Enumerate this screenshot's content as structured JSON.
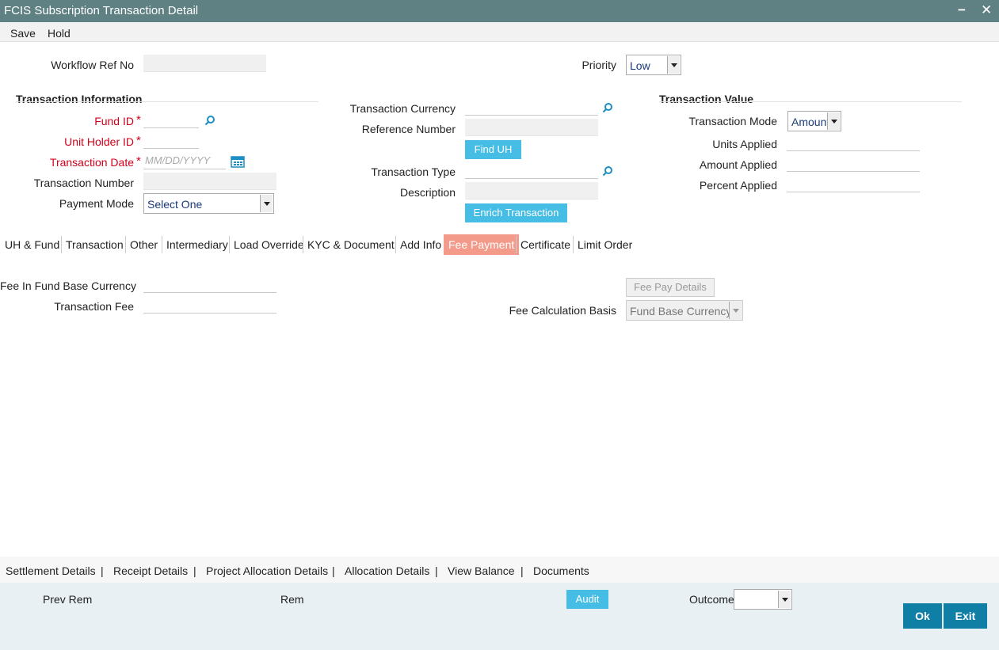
{
  "window": {
    "title": "FCIS Subscription Transaction Detail",
    "minimize_glyph": "−",
    "close_glyph": "✕"
  },
  "menu": {
    "save": "Save",
    "hold": "Hold"
  },
  "header": {
    "workflow_ref_label": "Workflow Ref No",
    "workflow_ref_value": "",
    "priority_label": "Priority",
    "priority_value": "Low"
  },
  "transaction_information": {
    "heading": "Transaction Information",
    "fund_id_label": "Fund ID",
    "unit_holder_id_label": "Unit Holder ID",
    "transaction_date_label": "Transaction Date",
    "transaction_date_placeholder": "MM/DD/YYYY",
    "transaction_number_label": "Transaction Number",
    "payment_mode_label": "Payment Mode",
    "payment_mode_value": "Select One",
    "required_marker": "*"
  },
  "middle": {
    "transaction_currency_label": "Transaction Currency",
    "reference_number_label": "Reference Number",
    "find_uh_button": "Find UH",
    "transaction_type_label": "Transaction Type",
    "description_label": "Description",
    "enrich_button": "Enrich Transaction"
  },
  "transaction_value": {
    "heading": "Transaction Value",
    "mode_label": "Transaction Mode",
    "mode_value": "Amount",
    "units_applied_label": "Units Applied",
    "amount_applied_label": "Amount Applied",
    "percent_applied_label": "Percent Applied"
  },
  "tabs": [
    "UH & Fund",
    "Transaction",
    "Other",
    "Intermediary",
    "Load Override",
    "KYC & Document",
    "Add Info",
    "Fee Payment",
    "Certificate",
    "Limit Order"
  ],
  "active_tab": "Fee Payment",
  "fee_payment": {
    "fee_in_fund_base_label": "Fee In Fund Base Currency",
    "transaction_fee_label": "Transaction Fee",
    "fee_pay_details_button": "Fee Pay Details",
    "fee_calc_basis_label": "Fee Calculation Basis",
    "fee_calc_basis_value": "Fund Base Currency"
  },
  "bottom_links": [
    "Settlement Details",
    "Receipt Details",
    "Project Allocation Details",
    "Allocation Details",
    "View Balance",
    "Documents"
  ],
  "bottom_link_separator": "|",
  "footer": {
    "prev_rem_label": "Prev Rem",
    "rem_label": "Rem",
    "audit_button": "Audit",
    "outcome_label": "Outcome",
    "outcome_value": "",
    "ok_button": "Ok",
    "exit_button": "Exit"
  },
  "colors": {
    "titlebar": "#5f8184",
    "accent_blue": "#46bde5",
    "active_tab": "#f49a8a",
    "required": "#d0021b",
    "primary_button": "#0f7fa6"
  }
}
